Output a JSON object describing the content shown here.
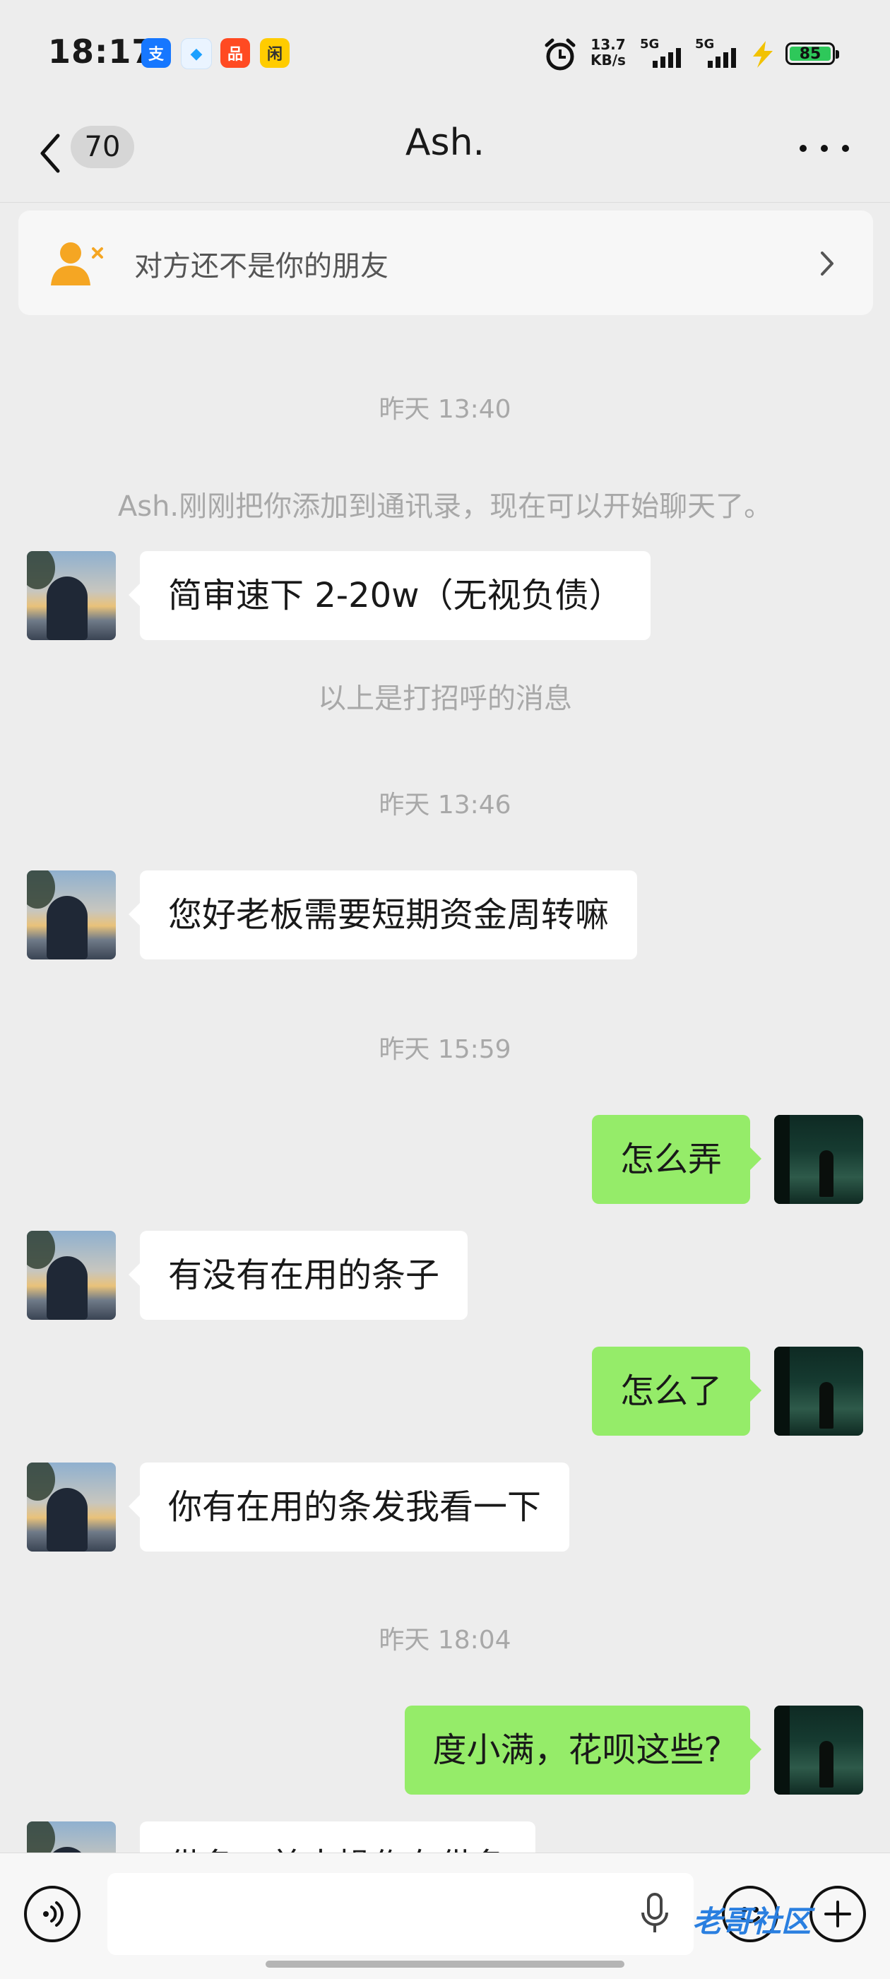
{
  "status_bar": {
    "time": "18:17",
    "app_icons": [
      {
        "name": "alipay-icon",
        "glyph": "支",
        "color": "#1677ff"
      },
      {
        "name": "app-icon",
        "glyph": "◆",
        "color": "#1aa0ff"
      },
      {
        "name": "taobao-icon",
        "glyph": "品",
        "color": "#ff4a22"
      },
      {
        "name": "quark-icon",
        "glyph": "闲",
        "color": "#ffcc00"
      }
    ],
    "net_speed": "13.7",
    "net_unit": "KB/s",
    "signal1": "5G",
    "signal2": "5G",
    "battery": "85"
  },
  "nav": {
    "unread_count": "70",
    "title": "Ash."
  },
  "notice": {
    "text": "对方还不是你的朋友"
  },
  "messages": {
    "ts1": "昨天 13:40",
    "sys_added": "Ash.刚刚把你添加到通讯录，现在可以开始聊天了。",
    "m1": "简审速下 2-20w（无视负债）",
    "sys_greeting": "以上是打招呼的消息",
    "ts2": "昨天 13:46",
    "m2": "您好老板需要短期资金周转嘛",
    "ts3": "昨天 15:59",
    "m3": "怎么弄",
    "m4": "有没有在用的条子",
    "m5": "怎么了",
    "m6": "你有在用的条发我看一下",
    "ts4": "昨天 18:04",
    "m7": "度小满，花呗这些?",
    "m8": "借条，美来操作在借条"
  },
  "watermark": "老哥社区",
  "colors": {
    "background": "#ededed",
    "outgoing_bubble": "#95ec69",
    "incoming_bubble": "#ffffff",
    "notice_icon": "#f5a623"
  }
}
